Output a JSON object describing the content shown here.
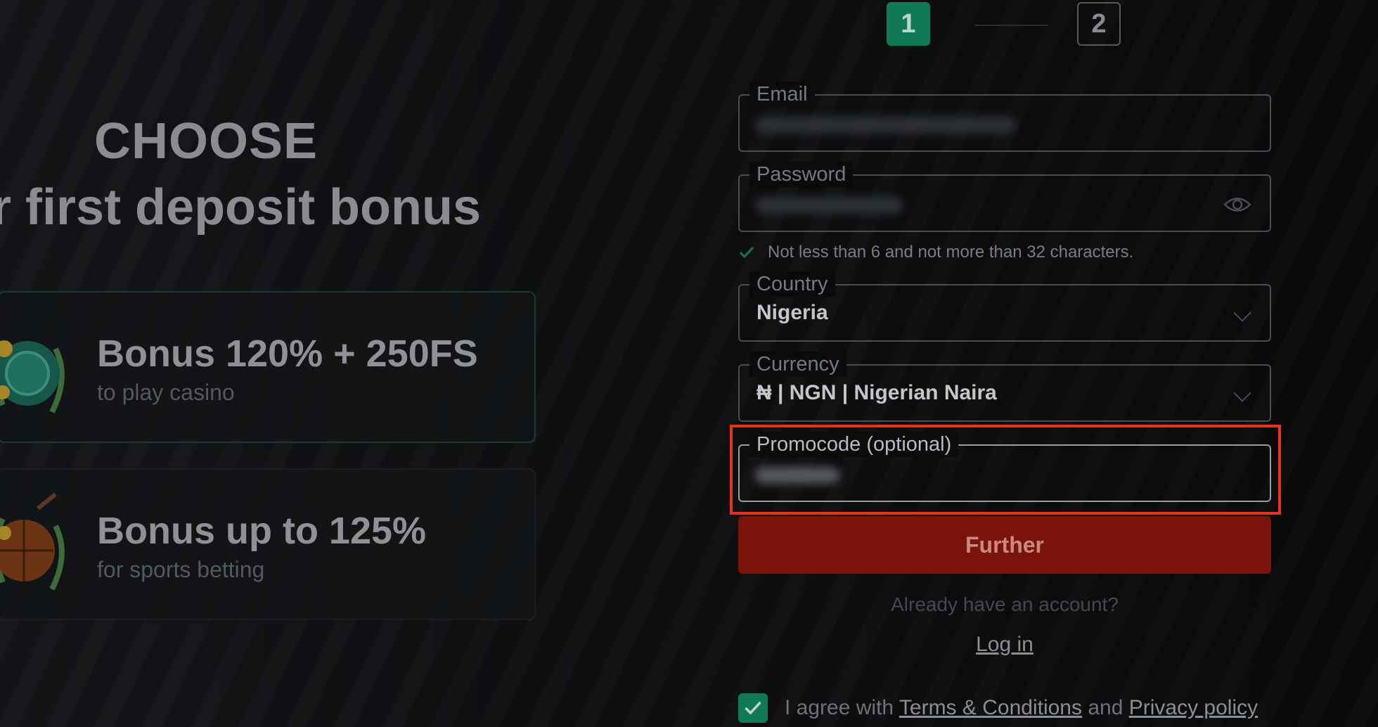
{
  "steps": {
    "step1": "1",
    "step2": "2"
  },
  "promo": {
    "heading_line1": "CHOOSE",
    "heading_line2": "r first deposit bonus",
    "cards": [
      {
        "title": "Bonus 120% + 250FS",
        "subtitle": "to play casino",
        "icon": "casino-chip-icon"
      },
      {
        "title": "Bonus up to 125%",
        "subtitle": "for sports betting",
        "icon": "basketball-icon"
      }
    ]
  },
  "form": {
    "email": {
      "label": "Email"
    },
    "password": {
      "label": "Password",
      "hint": "Not less than 6 and not more than 32 characters."
    },
    "country": {
      "label": "Country",
      "value": "Nigeria"
    },
    "currency": {
      "label": "Currency",
      "value": "₦ | NGN | Nigerian Naira"
    },
    "promocode": {
      "label": "Promocode (optional)"
    },
    "further_label": "Further",
    "already_text": "Already have an account?",
    "login_label": "Log in",
    "agree": {
      "prefix": "I agree with",
      "terms": "Terms & Conditions",
      "and": "and",
      "privacy": "Privacy policy"
    }
  },
  "colors": {
    "accent_green": "#0f7a55",
    "button_red": "#7a1309",
    "highlight_red": "#e8331c"
  }
}
